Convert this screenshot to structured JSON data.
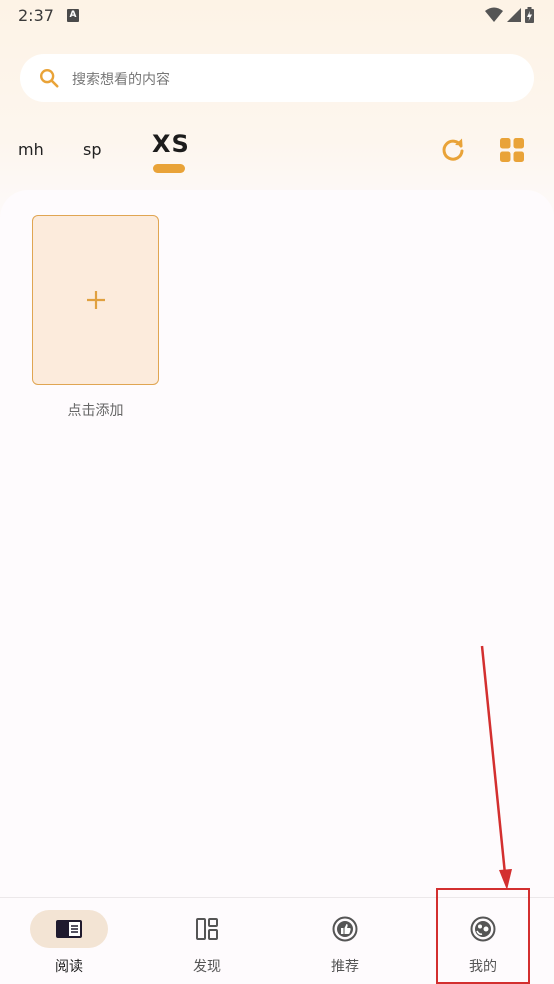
{
  "status_bar": {
    "time": "2:37",
    "notification_badge": "A"
  },
  "search": {
    "placeholder": "搜索想看的内容"
  },
  "tabs": [
    {
      "label": "mh",
      "selected": false
    },
    {
      "label": "sp",
      "selected": false
    },
    {
      "label": "XS",
      "selected": true
    }
  ],
  "toolbar": {
    "refresh_icon": "refresh-icon",
    "layout_icon": "grid-icon"
  },
  "add_card": {
    "label": "点击添加"
  },
  "bottom_nav": [
    {
      "label": "阅读",
      "icon": "book-icon",
      "active": true
    },
    {
      "label": "发现",
      "icon": "layout-icon",
      "active": false
    },
    {
      "label": "推荐",
      "icon": "thumbs-up-icon",
      "active": false
    },
    {
      "label": "我的",
      "icon": "face-icon",
      "active": false
    }
  ],
  "colors": {
    "accent": "#e9a338",
    "annotation": "#d32f2f",
    "card_bg": "#fcebdc"
  }
}
